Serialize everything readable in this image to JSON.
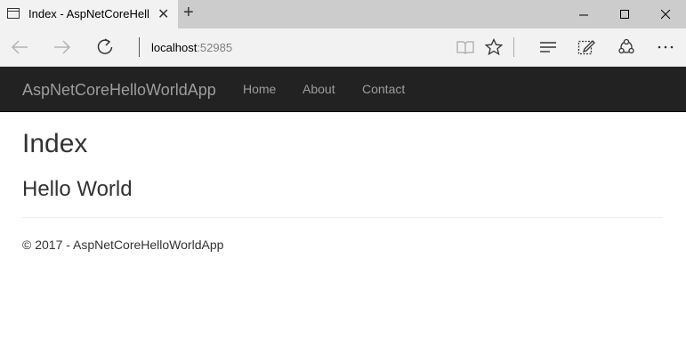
{
  "browser": {
    "tab_title": "Index - AspNetCoreHell",
    "url_host": "localhost",
    "url_port": ":52985",
    "icons": {
      "page": "page-icon",
      "close": "close-icon",
      "new_tab": "plus-icon",
      "back": "back-arrow-icon",
      "forward": "forward-arrow-icon",
      "refresh": "refresh-icon",
      "reading_view": "book-icon",
      "favorite": "star-icon",
      "hub": "hub-icon",
      "notes": "pen-icon",
      "share": "share-icon",
      "more": "more-icon",
      "minimize": "minimize-icon",
      "maximize": "maximize-icon",
      "window_close": "close-icon"
    }
  },
  "navbar": {
    "brand": "AspNetCoreHelloWorldApp",
    "links": [
      "Home",
      "About",
      "Contact"
    ],
    "bg_color": "#222222",
    "link_color": "#9d9d9d"
  },
  "main": {
    "title": "Index",
    "heading": "Hello World"
  },
  "footer": {
    "text": "© 2017 - AspNetCoreHelloWorldApp"
  }
}
